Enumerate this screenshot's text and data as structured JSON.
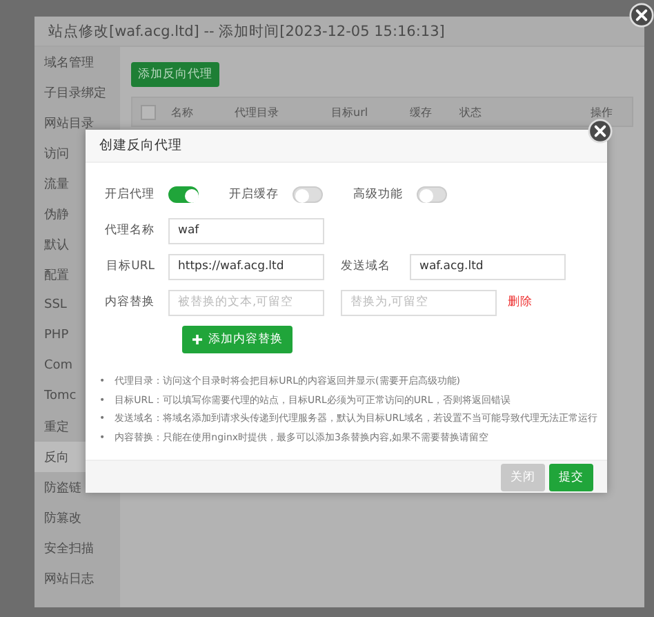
{
  "window": {
    "title": "站点修改[waf.acg.ltd] -- 添加时间[2023-12-05 15:16:13]"
  },
  "sidebar": {
    "items": [
      {
        "label": "域名管理",
        "selected": false
      },
      {
        "label": "子目录绑定",
        "selected": false
      },
      {
        "label": "网站目录",
        "selected": false
      },
      {
        "label": "访问",
        "selected": false
      },
      {
        "label": "流量",
        "selected": false
      },
      {
        "label": "伪静",
        "selected": false
      },
      {
        "label": "默认",
        "selected": false
      },
      {
        "label": "配置",
        "selected": false
      },
      {
        "label": "SSL",
        "selected": false
      },
      {
        "label": "PHP",
        "selected": false
      },
      {
        "label": "Com",
        "selected": false
      },
      {
        "label": "Tomc",
        "selected": false
      },
      {
        "label": "重定",
        "selected": false
      },
      {
        "label": "反向",
        "selected": true
      },
      {
        "label": "防盗链",
        "selected": false
      },
      {
        "label": "防篡改",
        "selected": false
      },
      {
        "label": "安全扫描",
        "selected": false
      },
      {
        "label": "网站日志",
        "selected": false
      }
    ]
  },
  "add_button": "添加反向代理",
  "table": {
    "select_all": {
      "checked": false
    },
    "columns": [
      "名称",
      "代理目录",
      "目标url",
      "缓存",
      "状态",
      "操作"
    ]
  },
  "modal": {
    "title": "创建反向代理",
    "toggles": [
      {
        "label": "开启代理",
        "on": true
      },
      {
        "label": "开启缓存",
        "on": false
      },
      {
        "label": "高级功能",
        "on": false
      }
    ],
    "name_field": {
      "label": "代理名称",
      "value": "waf"
    },
    "target_field": {
      "label": "目标URL",
      "value": "https://waf.acg.ltd"
    },
    "domain_field": {
      "label": "发送域名",
      "value": "waf.acg.ltd"
    },
    "replace": {
      "label": "内容替换",
      "from_placeholder": "被替换的文本,可留空",
      "to_placeholder": "替换为,可留空",
      "delete": "删除"
    },
    "add_replace_button": "添加内容替换",
    "notes": [
      {
        "bullet": "•",
        "text": "代理目录：访问这个目录时将会把目标URL的内容返回并显示(需要开启高级功能)"
      },
      {
        "bullet": "•",
        "text": "目标URL：可以填写你需要代理的站点，目标URL必须为可正常访问的URL，否则将返回错误"
      },
      {
        "bullet": "•",
        "text": "发送域名：将域名添加到请求头传递到代理服务器，默认为目标URL域名，若设置不当可能导致代理无法正常运行"
      },
      {
        "bullet": "•",
        "text": "内容替换：只能在使用nginx时提供，最多可以添加3条替换内容,如果不需要替换请留空"
      }
    ],
    "buttons": [
      {
        "label": "关闭",
        "kind": "secondary"
      },
      {
        "label": "提交",
        "kind": "primary"
      }
    ]
  }
}
